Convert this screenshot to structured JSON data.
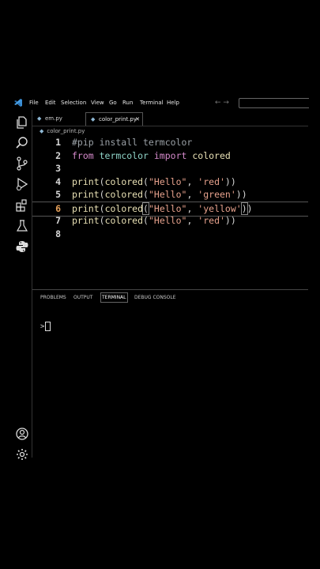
{
  "menubar": {
    "items": [
      "File",
      "Edit",
      "Selection",
      "View",
      "Go",
      "Run",
      "Terminal",
      "Help"
    ],
    "nav_arrows": "← →"
  },
  "tabs": [
    {
      "label": "em.py",
      "icon": "python-file-icon",
      "active": false
    },
    {
      "label": "color_print.py",
      "icon": "python-file-icon",
      "active": true,
      "close": "✕"
    }
  ],
  "breadcrumb": "color_print.py",
  "editor": {
    "active_line": 6,
    "lines": [
      {
        "num": "1",
        "tokens": [
          {
            "t": "#pip install termcolor",
            "c": "c-comment"
          }
        ]
      },
      {
        "num": "2",
        "tokens": [
          {
            "t": "from ",
            "c": "c-kw"
          },
          {
            "t": "termcolor ",
            "c": "c-mod"
          },
          {
            "t": "import ",
            "c": "c-kw"
          },
          {
            "t": "colored",
            "c": "c-fn"
          }
        ]
      },
      {
        "num": "3",
        "tokens": []
      },
      {
        "num": "4",
        "tokens": [
          {
            "t": "print",
            "c": "c-fn"
          },
          {
            "t": "(",
            "c": "c-plain"
          },
          {
            "t": "colored",
            "c": "c-fn"
          },
          {
            "t": "(",
            "c": "c-plain"
          },
          {
            "t": "\"Hello\"",
            "c": "c-str"
          },
          {
            "t": ", ",
            "c": "c-plain"
          },
          {
            "t": "'red'",
            "c": "c-str"
          },
          {
            "t": "))",
            "c": "c-plain"
          }
        ]
      },
      {
        "num": "5",
        "tokens": [
          {
            "t": "print",
            "c": "c-fn"
          },
          {
            "t": "(",
            "c": "c-plain"
          },
          {
            "t": "colored",
            "c": "c-fn"
          },
          {
            "t": "(",
            "c": "c-plain"
          },
          {
            "t": "\"Hello\"",
            "c": "c-str"
          },
          {
            "t": ", ",
            "c": "c-plain"
          },
          {
            "t": "'green'",
            "c": "c-str"
          },
          {
            "t": "))",
            "c": "c-plain"
          }
        ]
      },
      {
        "num": "6",
        "tokens": [
          {
            "t": "print",
            "c": "c-fn"
          },
          {
            "t": "(",
            "c": "c-plain"
          },
          {
            "t": "colored",
            "c": "c-fn"
          },
          {
            "t": "(",
            "c": "c-plain paren-hl"
          },
          {
            "t": "\"Hello\"",
            "c": "c-str"
          },
          {
            "t": ", ",
            "c": "c-plain"
          },
          {
            "t": "'yellow'",
            "c": "c-str"
          },
          {
            "t": ")",
            "c": "c-plain paren-hl"
          },
          {
            "t": ")",
            "c": "c-plain"
          }
        ]
      },
      {
        "num": "7",
        "tokens": [
          {
            "t": "print",
            "c": "c-fn"
          },
          {
            "t": "(",
            "c": "c-plain"
          },
          {
            "t": "colored",
            "c": "c-fn"
          },
          {
            "t": "(",
            "c": "c-plain"
          },
          {
            "t": "\"Hello\"",
            "c": "c-str"
          },
          {
            "t": ", ",
            "c": "c-plain"
          },
          {
            "t": "'red'",
            "c": "c-str"
          },
          {
            "t": "))",
            "c": "c-plain"
          }
        ]
      },
      {
        "num": "8",
        "tokens": []
      }
    ]
  },
  "panel": {
    "tabs": [
      "PROBLEMS",
      "OUTPUT",
      "TERMINAL",
      "DEBUG CONSOLE"
    ],
    "active_tab": "TERMINAL",
    "prompt": ">"
  },
  "activity_bar": [
    "explorer-icon",
    "search-icon",
    "source-control-icon",
    "run-debug-icon",
    "extensions-icon",
    "testing-icon",
    "python-icon",
    "account-icon",
    "settings-icon"
  ]
}
